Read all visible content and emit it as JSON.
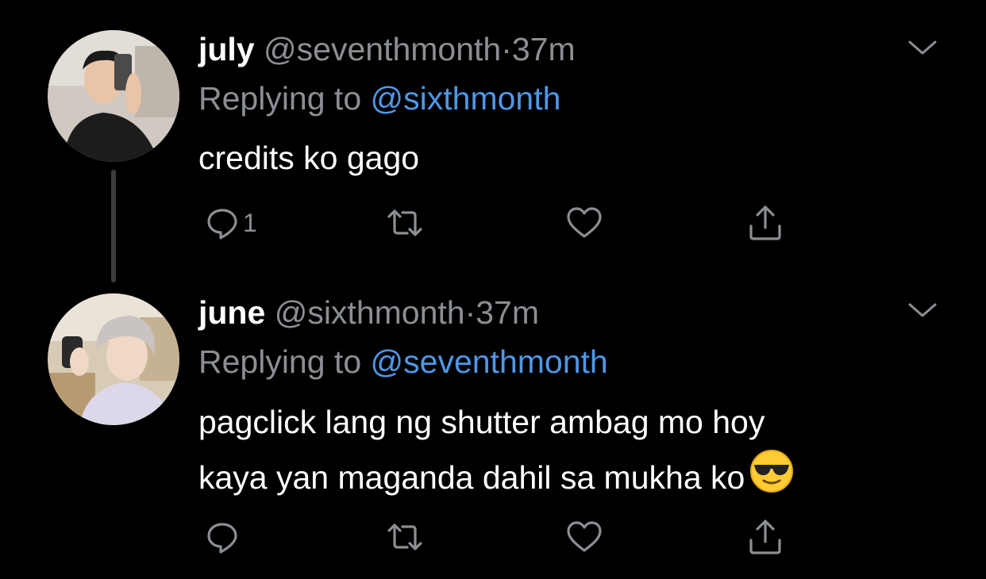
{
  "tweets": [
    {
      "display_name": "july",
      "handle": "@seventhmonth",
      "separator": "·",
      "time": "37m",
      "replying_label": "Replying to",
      "replying_to": "@sixthmonth",
      "text": "credits ko gago",
      "reply_count": "1",
      "avatar_icon": "avatar-photo"
    },
    {
      "display_name": "june",
      "handle": "@sixthmonth",
      "separator": "·",
      "time": "37m",
      "replying_label": "Replying to",
      "replying_to": "@seventhmonth",
      "text_line_1": "pagclick lang ng shutter ambag mo hoy",
      "text_line_2": "kaya yan maganda dahil sa mukha ko",
      "emoji": "😎",
      "reply_count": "",
      "avatar_icon": "avatar-photo"
    }
  ],
  "icons": {
    "reply": "reply-icon",
    "retweet": "retweet-icon",
    "like": "heart-icon",
    "share": "share-icon",
    "more": "chevron-down-icon"
  },
  "colors": {
    "background": "#000000",
    "text": "#ffffff",
    "muted": "#8b8f94",
    "link": "#4f97e6",
    "thread_line": "#3a3d40"
  }
}
